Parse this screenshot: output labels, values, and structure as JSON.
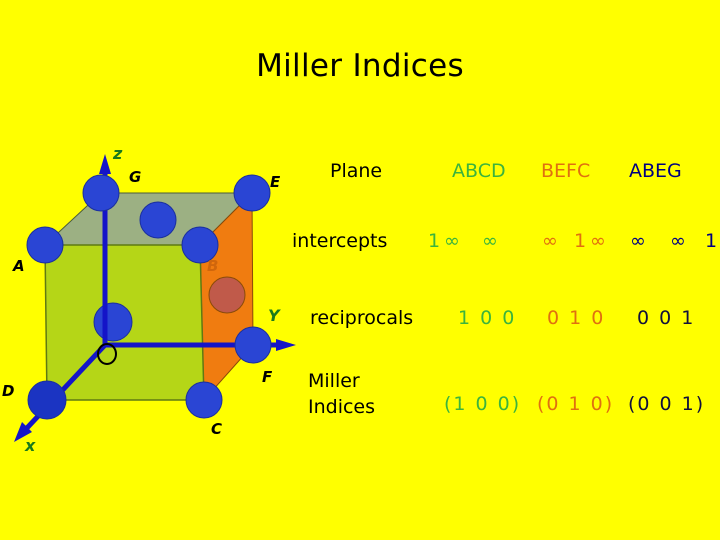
{
  "slide": {
    "background_color": "#ffff00",
    "title": "Miller Indices"
  },
  "figure": {
    "name": "cubic-unit-cell",
    "axes": [
      {
        "label": "z",
        "color": "#1b7a1b"
      },
      {
        "label": "Y",
        "color": "#1b7a1b"
      },
      {
        "label": "x",
        "color": "#1b7a1b"
      }
    ],
    "origin_label": "O",
    "vertices": [
      {
        "label": "G"
      },
      {
        "label": "E"
      },
      {
        "label": "A"
      },
      {
        "label": "B"
      },
      {
        "label": "D"
      },
      {
        "label": "C"
      },
      {
        "label": "F"
      }
    ],
    "colors": {
      "front_face": "#b5d617",
      "top_face": "#9cb083",
      "right_face": "#f07c10",
      "axis": "#1414c8",
      "atom": "#2a45d4",
      "edge": "#333333"
    }
  },
  "table": {
    "row_labels": [
      "Plane",
      "intercepts",
      "reciprocals",
      "Miller\nIndices"
    ],
    "row_label_plane": "Plane",
    "row_label_intercepts": "intercepts",
    "row_label_reciprocals": "reciprocals",
    "row_label_miller_line1": "Miller",
    "row_label_miller_line2": "Indices",
    "columns": [
      {
        "header": "ABCD",
        "color": "#3cb43c",
        "intercepts": [
          "1",
          "∞",
          "∞"
        ],
        "intercepts_text": "1 ∞  ∞",
        "reciprocals": "1 0 0",
        "miller": "(1 0 0)"
      },
      {
        "header": "BEFC",
        "color": "#e0700f",
        "intercepts": [
          "∞",
          "1",
          "∞"
        ],
        "intercepts_text": "∞ 1 ∞",
        "reciprocals": "0 1 0",
        "miller": "(0 1 0)"
      },
      {
        "header": "ABEG",
        "color": "#000080",
        "intercepts": [
          "∞",
          "∞",
          "1"
        ],
        "intercepts_text": "∞ ∞ 1",
        "reciprocals": "0 0 1",
        "miller": "(0 0 1)"
      }
    ],
    "intercepts_abcd_1": "1",
    "intercepts_abcd_2": "∞",
    "intercepts_abcd_3": "∞",
    "intercepts_befc_1": "∞",
    "intercepts_befc_2": "1",
    "intercepts_befc_3": "∞",
    "intercepts_abeg_1": "∞",
    "intercepts_abeg_2": "∞",
    "intercepts_abeg_3": "1"
  }
}
